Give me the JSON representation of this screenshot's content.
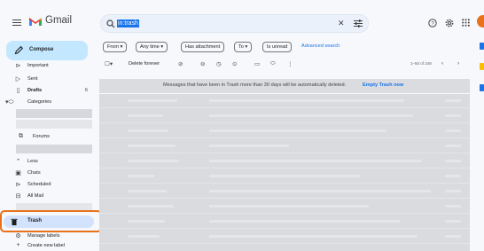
{
  "app": {
    "name": "Gmail"
  },
  "search": {
    "value": "in:trash"
  },
  "compose": {
    "label": "Compose"
  },
  "sidebar": {
    "items": [
      {
        "label": "Important",
        "icon": "label-important-icon"
      },
      {
        "label": "Sent",
        "icon": "send-icon"
      },
      {
        "label": "Drafts",
        "icon": "draft-icon",
        "count": "6",
        "bold": true
      },
      {
        "label": "Categories",
        "icon": "label-icon"
      },
      {
        "label": "Forums",
        "icon": "forum-icon"
      },
      {
        "label": "Less",
        "icon": "chevron-up-icon"
      },
      {
        "label": "Chats",
        "icon": "chat-icon"
      },
      {
        "label": "Scheduled",
        "icon": "schedule-send-icon"
      },
      {
        "label": "All Mail",
        "icon": "all-mail-icon"
      },
      {
        "label": "Trash",
        "icon": "trash-icon",
        "active": true
      },
      {
        "label": "Manage labels",
        "icon": "gear-icon"
      },
      {
        "label": "Create new label",
        "icon": "plus-icon"
      }
    ]
  },
  "filters": {
    "from": "From",
    "any_time": "Any time",
    "has_attachment": "Has attachment",
    "to": "To",
    "is_unread": "Is unread",
    "advanced_search": "Advanced search"
  },
  "toolbar": {
    "delete_forever": "Delete forever",
    "range": "1–50 of 248"
  },
  "banner": {
    "message": "Messages that have been in Trash more than 30 days will be automatically deleted.",
    "action": "Empty Trash now"
  },
  "colors": {
    "accent": "#1a73e8",
    "compose_bg": "#c2e7ff",
    "active_bg": "#d3e3fd",
    "highlight": "#e8711a"
  }
}
